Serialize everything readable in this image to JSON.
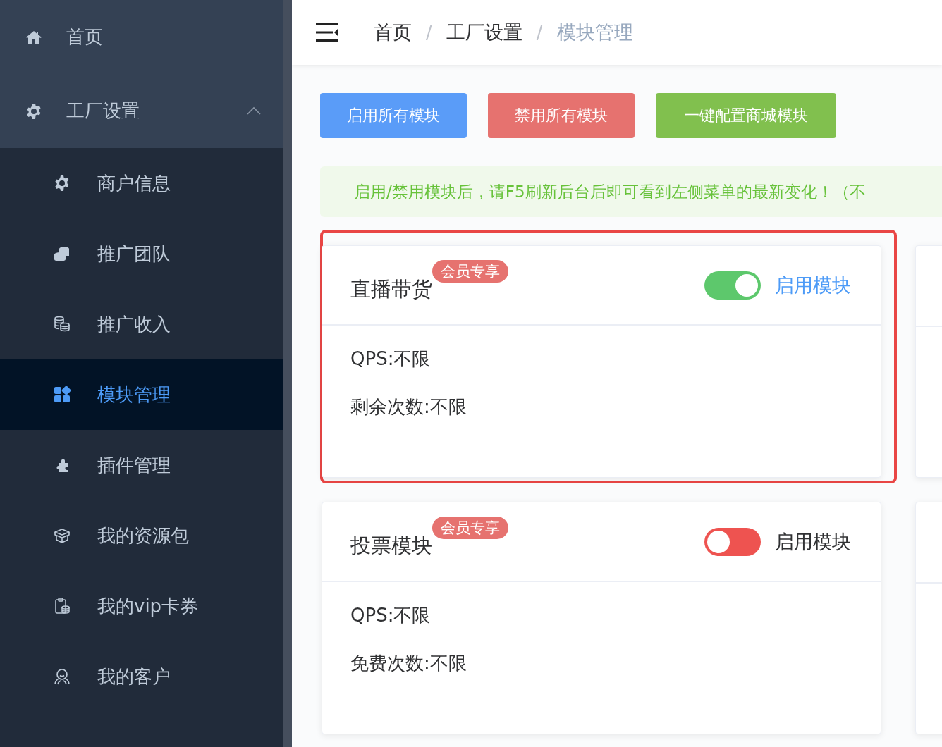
{
  "sidebar": {
    "items": [
      {
        "label": "首页",
        "selected": false
      },
      {
        "label": "工厂设置",
        "selected": false,
        "expanded": true,
        "children": [
          {
            "label": "商户信息",
            "selected": false
          },
          {
            "label": "推广团队",
            "selected": false
          },
          {
            "label": "推广收入",
            "selected": false
          },
          {
            "label": "模块管理",
            "selected": true
          },
          {
            "label": "插件管理",
            "selected": false
          },
          {
            "label": "我的资源包",
            "selected": false
          },
          {
            "label": "我的vip卡券",
            "selected": false
          },
          {
            "label": "我的客户",
            "selected": false
          }
        ]
      }
    ]
  },
  "breadcrumb": [
    {
      "label": "首页",
      "kind": "link"
    },
    {
      "label": "/",
      "kind": "separator"
    },
    {
      "label": "工厂设置",
      "kind": "link"
    },
    {
      "label": "/",
      "kind": "separator"
    },
    {
      "label": "模块管理",
      "kind": "current"
    }
  ],
  "actions": [
    {
      "label": "启用所有模块",
      "kind": "primary"
    },
    {
      "label": "禁用所有模块",
      "kind": "danger"
    },
    {
      "label": "一键配置商城模块",
      "kind": "success"
    }
  ],
  "notice": "启用/禁用模块后，请F5刷新后台后即可看到左侧菜单的最新变化！（不",
  "modules": [
    {
      "title": "直播带货",
      "badge": "会员专享",
      "on": true,
      "toggle_label": "启用模块",
      "highlighted": true,
      "lines": [
        "QPS:不限",
        "剩余次数:不限"
      ]
    },
    {
      "title": "投票模块",
      "badge": "会员专享",
      "on": false,
      "toggle_label": "启用模块",
      "highlighted": false,
      "lines": [
        "QPS:不限",
        "免费次数:不限"
      ]
    }
  ]
}
